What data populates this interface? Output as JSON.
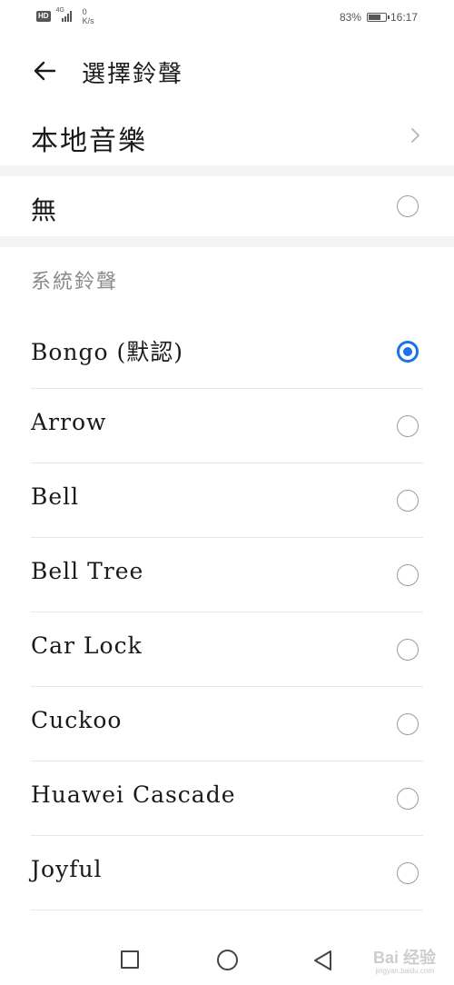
{
  "status_bar": {
    "hd": "HD",
    "network": "4G",
    "speed_value": "0",
    "speed_unit": "K/s",
    "battery_percent": "83%",
    "battery_level": 0.83,
    "time": "16:17"
  },
  "header": {
    "title": "選擇鈴聲"
  },
  "local_music": {
    "label": "本地音樂"
  },
  "none_option": {
    "label": "無",
    "selected": false
  },
  "system_section": {
    "title": "系統鈴聲",
    "items": [
      {
        "label": "Bongo (默認)",
        "selected": true
      },
      {
        "label": "Arrow",
        "selected": false
      },
      {
        "label": "Bell",
        "selected": false
      },
      {
        "label": "Bell Tree",
        "selected": false
      },
      {
        "label": "Car Lock",
        "selected": false
      },
      {
        "label": "Cuckoo",
        "selected": false
      },
      {
        "label": "Huawei Cascade",
        "selected": false
      },
      {
        "label": "Joyful",
        "selected": false
      }
    ]
  },
  "watermark": {
    "text": "Bai 经验",
    "url": "jingyan.baidu.com"
  },
  "colors": {
    "accent": "#1a73e8",
    "section_gap": "#f3f3f3",
    "divider": "#e6e6e6"
  }
}
